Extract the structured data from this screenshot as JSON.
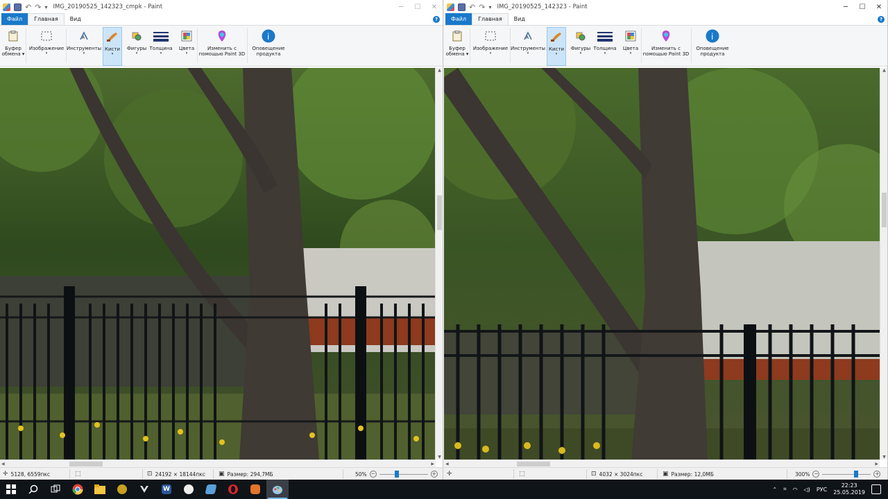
{
  "windows": [
    {
      "id": "left",
      "title": "IMG_20190525_142323_cmpk - Paint",
      "tabs": [
        "Файл",
        "Главная",
        "Вид"
      ],
      "ribbon": [
        {
          "l1": "Буфер",
          "l2": "обмена",
          "icon": "clipboard-icon"
        },
        {
          "l1": "Изображение",
          "l2": "",
          "icon": "select-icon"
        },
        {
          "l1": "Инструменты",
          "l2": "",
          "icon": "tools-icon"
        },
        {
          "l1": "Кисти",
          "l2": "",
          "icon": "brush-icon"
        },
        {
          "l1": "Фигуры",
          "l2": "",
          "icon": "shapes-icon"
        },
        {
          "l1": "Толщина",
          "l2": "",
          "icon": "thickness-icon"
        },
        {
          "l1": "Цвета",
          "l2": "",
          "icon": "palette-icon"
        },
        {
          "l1": "Изменить с",
          "l2": "помощью Paint 3D",
          "icon": "paint3d-icon"
        },
        {
          "l1": "Оповещение",
          "l2": "продукта",
          "icon": "info-icon"
        }
      ],
      "status": {
        "cursor": "5128, 6559пкс",
        "selection": "",
        "dimensions": "24192 × 18144пкс",
        "size": "Размер: 294,7МБ",
        "zoom": "50%",
        "zoom_level": 0.5
      }
    },
    {
      "id": "right",
      "title": "IMG_20190525_142323 - Paint",
      "tabs": [
        "Файл",
        "Главная",
        "Вид"
      ],
      "ribbon": [
        {
          "l1": "Буфер",
          "l2": "обмена",
          "icon": "clipboard-icon"
        },
        {
          "l1": "Изображение",
          "l2": "",
          "icon": "select-icon"
        },
        {
          "l1": "Инструменты",
          "l2": "",
          "icon": "tools-icon"
        },
        {
          "l1": "Кисти",
          "l2": "",
          "icon": "brush-icon"
        },
        {
          "l1": "Фигуры",
          "l2": "",
          "icon": "shapes-icon"
        },
        {
          "l1": "Толщина",
          "l2": "",
          "icon": "thickness-icon"
        },
        {
          "l1": "Цвета",
          "l2": "",
          "icon": "palette-icon"
        },
        {
          "l1": "Изменить с",
          "l2": "помощью Paint 3D",
          "icon": "paint3d-icon"
        },
        {
          "l1": "Оповещение",
          "l2": "продукта",
          "icon": "info-icon"
        }
      ],
      "status": {
        "cursor": "",
        "selection": "",
        "dimensions": "4032 × 3024пкс",
        "size": "Размер: 12,0МБ",
        "zoom": "300%",
        "zoom_level": 3.0
      }
    }
  ],
  "taskbar": {
    "apps": [
      "start-icon",
      "search-icon",
      "task-view-icon",
      "chrome-icon",
      "file-explorer-icon",
      "app-icon",
      "app-icon",
      "word-icon",
      "app-icon",
      "app-icon",
      "opera-icon",
      "app-icon",
      "paint-icon"
    ],
    "tray": {
      "lang": "РУС",
      "time": "22:23",
      "date": "25.05.2019"
    }
  },
  "colors": {
    "accent": "#1979ca",
    "ribbon_bg": "#f5f6f7",
    "taskbar_bg": "#0f1419"
  }
}
